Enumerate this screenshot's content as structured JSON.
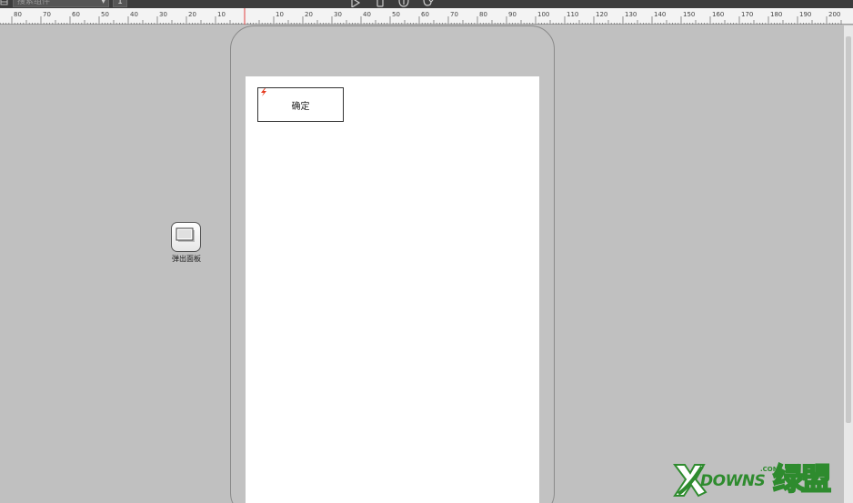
{
  "toolbar": {
    "search_placeholder": "搜索组件",
    "page_number": "1",
    "tools": [
      "play-icon",
      "mobile-preview-icon",
      "share-icon",
      "sync-icon"
    ]
  },
  "ruler": {
    "labels": [
      "80",
      "70",
      "60",
      "50",
      "40",
      "30",
      "20",
      "10",
      "10",
      "20",
      "30",
      "40",
      "50",
      "60",
      "70",
      "80",
      "90",
      "100",
      "110",
      "120",
      "130",
      "140",
      "150",
      "160",
      "170",
      "180",
      "190",
      "200"
    ]
  },
  "canvas": {
    "button_label": "确定",
    "panel_label": "弹出面板"
  },
  "watermark": {
    "brand": "DOWNS",
    "domain_suffix": ".COM",
    "chinese": "绿盟"
  },
  "colors": {
    "toolbar_bg": "#3c3c3c",
    "canvas_bg": "#c0c0c0",
    "screen_bg": "#ffffff",
    "ruler_marker": "#e04040",
    "interaction_icon": "#e53a1e",
    "watermark_green": "#2e8b2e"
  }
}
